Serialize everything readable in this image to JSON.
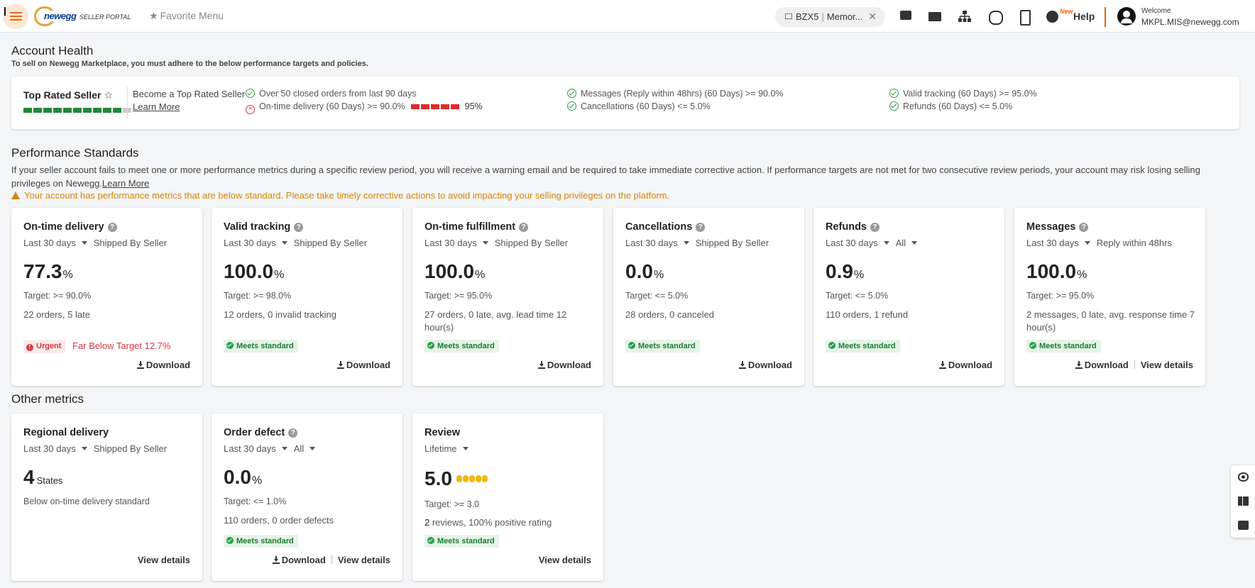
{
  "header": {
    "logo_text": "newegg",
    "logo_sub": "SELLER PORTAL",
    "favorite_menu": "Favorite Menu",
    "store_code": "BZX5",
    "store_name": "Memor...",
    "new_badge": "New",
    "help_label": "Help",
    "welcome": "Welcome",
    "email": "MKPL.MIS@newegg.com"
  },
  "account_health": {
    "title": "Account Health",
    "subtitle": "To sell on Newegg Marketplace, you must adhere to the below performance targets and policies.",
    "top_rated_title": "Top Rated Seller",
    "progress": {
      "filled": 10,
      "total": 11
    },
    "become": "Become a Top Rated Seller",
    "learn_more": "Learn More",
    "criteria": [
      {
        "text": "Over 50 closed orders from last 90 days",
        "status": "pass"
      },
      {
        "text": "On-time delivery (60 Days) >= 90.0%",
        "status": "fail",
        "bar_value": "95%"
      },
      {
        "text": "Messages (Reply within 48hrs) (60 Days) >= 90.0%",
        "status": "pass"
      },
      {
        "text": "Cancellations (60 Days) <= 5.0%",
        "status": "pass"
      },
      {
        "text": "Valid tracking (60 Days) >= 95.0%",
        "status": "pass"
      },
      {
        "text": "Refunds (60 Days) <= 5.0%",
        "status": "pass"
      }
    ]
  },
  "performance": {
    "title": "Performance Standards",
    "description": "If your seller account fails to meet one or more performance metrics during a specific review period, you will receive a warning email and be required to take immediate corrective action. If performance targets are not met for two consecutive review periods, your account may risk losing selling privileges on Newegg.",
    "learn_more": "Learn More",
    "warning": "Your account has performance metrics that are below standard. Please take timely corrective actions to avoid impacting your selling privileges on the platform.",
    "cards": [
      {
        "title": "On-time delivery",
        "period": "Last 30 days",
        "scope": "Shipped By Seller",
        "value": "77.3",
        "unit": "%",
        "target": "Target: >= 90.0%",
        "detail": "22 orders, 5 late",
        "badge": "Urgent",
        "note": "Far Below Target 12.7%",
        "download": "Download"
      },
      {
        "title": "Valid tracking",
        "period": "Last 30 days",
        "scope": "Shipped By Seller",
        "value": "100.0",
        "unit": "%",
        "target": "Target: >= 98.0%",
        "detail": "12 orders, 0 invalid tracking",
        "badge": "Meets standard",
        "download": "Download"
      },
      {
        "title": "On-time fulfillment",
        "period": "Last 30 days",
        "scope": "Shipped By Seller",
        "value": "100.0",
        "unit": "%",
        "target": "Target: >= 95.0%",
        "detail": "27 orders, 0 late, avg. lead time 12 hour(s)",
        "badge": "Meets standard",
        "download": "Download"
      },
      {
        "title": "Cancellations",
        "period": "Last 30 days",
        "scope": "Shipped By Seller",
        "value": "0.0",
        "unit": "%",
        "target": "Target: <= 5.0%",
        "detail": "28 orders, 0 canceled",
        "badge": "Meets standard",
        "download": "Download"
      },
      {
        "title": "Refunds",
        "period": "Last 30 days",
        "scope": "All",
        "value": "0.9",
        "unit": "%",
        "target": "Target: <= 5.0%",
        "detail": "110 orders, 1 refund",
        "badge": "Meets standard",
        "download": "Download"
      },
      {
        "title": "Messages",
        "period": "Last 30 days",
        "scope": "Reply within 48hrs",
        "value": "100.0",
        "unit": "%",
        "target": "Target: >= 95.0%",
        "detail": "2 messages, 0 late, avg. response time 7 hour(s)",
        "badge": "Meets standard",
        "download": "Download",
        "view_details": "View details"
      }
    ]
  },
  "other": {
    "title": "Other metrics",
    "regional": {
      "title": "Regional delivery",
      "period": "Last 30 days",
      "scope": "Shipped By Seller",
      "value": "4",
      "unit": "States",
      "detail": "Below on-time delivery standard",
      "view_details": "View details"
    },
    "order_defect": {
      "title": "Order defect",
      "period": "Last 30 days",
      "scope": "All",
      "value": "0.0",
      "unit": "%",
      "target": "Target: <= 1.0%",
      "detail": "110 orders, 0 order defects",
      "badge": "Meets standard",
      "download": "Download",
      "view_details": "View details"
    },
    "review": {
      "title": "Review",
      "period": "Lifetime",
      "value": "5.0",
      "rating": 5,
      "target": "Target: >= 3.0",
      "detail_count": "2",
      "detail": " reviews, 100% positive rating",
      "badge": "Meets standard",
      "view_details": "View details"
    }
  },
  "icons": {
    "menu": "menu-icon",
    "star": "star-outline-icon",
    "chat": "chat-icon",
    "mail": "mail-icon",
    "sitemap": "sitemap-icon",
    "globe": "globe-icon",
    "mobile": "mobile-download-icon",
    "help": "help-reddit-icon",
    "account": "account-circle-icon",
    "eye": "eye-icon",
    "book": "book-icon",
    "feedback": "feedback-icon"
  },
  "colors": {
    "accent": "#e8650a",
    "pass": "#2a9d4b",
    "fail": "#d9363e",
    "warning": "#d4850a",
    "rating": "#f2b705"
  }
}
